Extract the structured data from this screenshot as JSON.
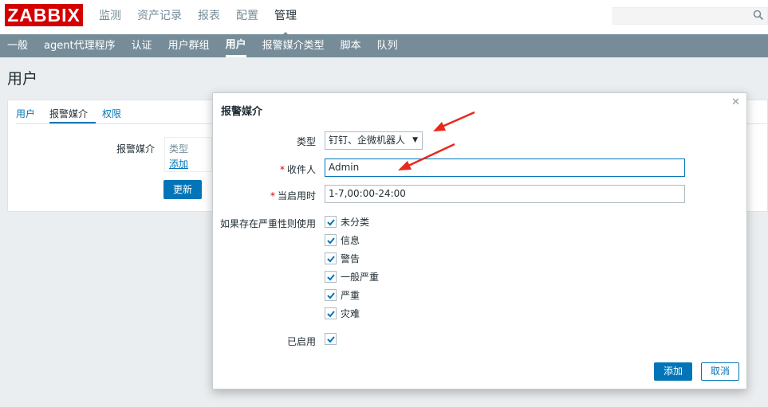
{
  "app": {
    "logo": "ZABBIX"
  },
  "topnav": {
    "items": [
      "监测",
      "资产记录",
      "报表",
      "配置",
      "管理"
    ],
    "active_index": 4
  },
  "search": {
    "placeholder": ""
  },
  "subnav": {
    "items": [
      "一般",
      "agent代理程序",
      "认证",
      "用户群组",
      "用户",
      "报警媒介类型",
      "脚本",
      "队列"
    ],
    "active_index": 4
  },
  "page": {
    "title": "用户"
  },
  "panel": {
    "tabs": [
      "用户",
      "报警媒介",
      "权限"
    ],
    "active_tab_index": 1,
    "media_label": "报警媒介",
    "media_type_header": "类型",
    "media_add_link": "添加",
    "update_button": "更新"
  },
  "dialog": {
    "title": "报警媒介",
    "close_icon": "close-icon",
    "type_label": "类型",
    "type_value": "钉钉、企微机器人",
    "recipient_label": "收件人",
    "recipient_value": "Admin",
    "when_active_label": "当启用时",
    "when_active_value": "1-7,00:00-24:00",
    "severity_label": "如果存在严重性则使用",
    "severities": [
      "未分类",
      "信息",
      "警告",
      "一般严重",
      "严重",
      "灾难"
    ],
    "enabled_label": "已启用",
    "add_button": "添加",
    "cancel_button": "取消"
  },
  "colors": {
    "brand": "#d40000",
    "accent": "#0275b8",
    "nav": "#768d99",
    "annotation_arrow": "#e8291c"
  }
}
